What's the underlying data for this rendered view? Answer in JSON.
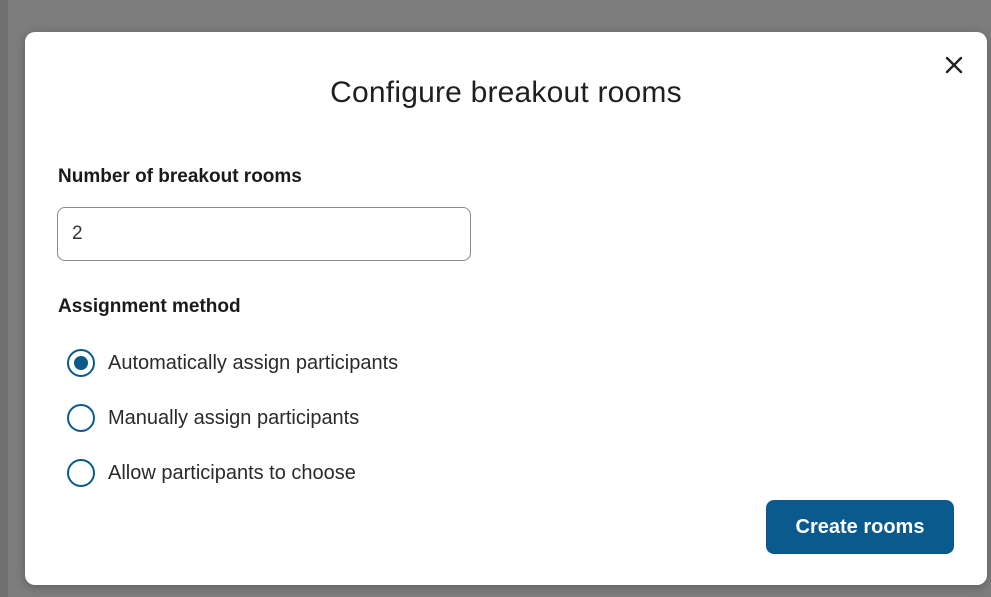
{
  "dialog": {
    "title": "Configure breakout rooms",
    "close_icon": "close-icon"
  },
  "rooms": {
    "label": "Number of breakout rooms",
    "value": "2"
  },
  "assignment": {
    "label": "Assignment method",
    "options": [
      {
        "label": "Automatically assign participants",
        "selected": true
      },
      {
        "label": "Manually assign participants",
        "selected": false
      },
      {
        "label": "Allow participants to choose",
        "selected": false
      }
    ]
  },
  "actions": {
    "create_label": "Create rooms"
  },
  "colors": {
    "accent": "#0a5a8e",
    "backdrop": "#7d7d7d",
    "dialog_bg": "#ffffff"
  }
}
